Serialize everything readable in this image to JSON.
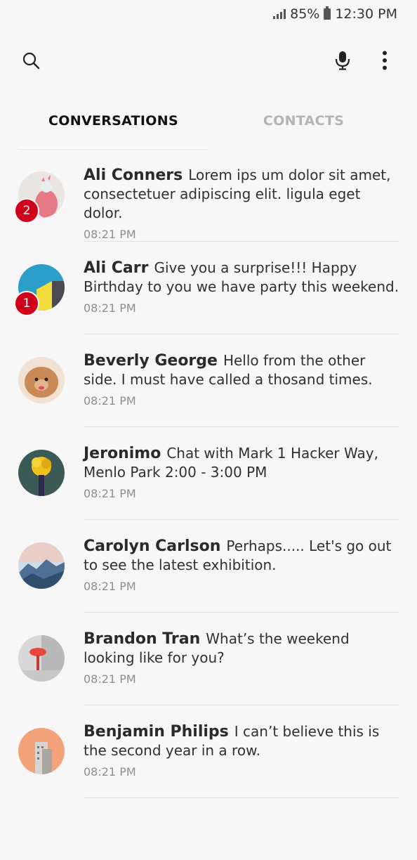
{
  "status_bar": {
    "battery": "85%",
    "time": "12:30 PM"
  },
  "tabs": [
    {
      "label": "CONVERSATIONS",
      "active": true
    },
    {
      "label": "CONTACTS",
      "active": false
    }
  ],
  "conversations": [
    {
      "name": "Ali Conners",
      "message": "Lorem ips um dolor sit amet, consectetuer adipiscing elit. ligula eget dolor.",
      "time": "08:21 PM",
      "unread": "2"
    },
    {
      "name": "Ali Carr",
      "message": "Give you a surprise!!! Happy Birthday to you we have party this weekend.",
      "time": "08:21 PM",
      "unread": "1"
    },
    {
      "name": "Beverly George",
      "message": "Hello from the other side. I must have called a thosand times.",
      "time": "08:21 PM"
    },
    {
      "name": "Jeronimo",
      "message": "Chat with Mark 1 Hacker Way, Menlo Park 2:00 - 3:00 PM",
      "time": "08:21 PM"
    },
    {
      "name": "Carolyn Carlson",
      "message": "Perhaps..... Let's go out to see the latest exhibition.",
      "time": "08:21 PM"
    },
    {
      "name": "Brandon Tran",
      "message": "What’s the weekend looking like for you?",
      "time": "08:21 PM"
    },
    {
      "name": "Benjamin Philips",
      "message": "I can’t believe this is the second year in a row.",
      "time": "08:21 PM"
    }
  ],
  "colors": {
    "badge": "#d0021b",
    "background": "#f7f7f7",
    "inactive_tab": "#b4b4b4"
  },
  "icons": {
    "search": "search-icon",
    "mic": "microphone-icon",
    "more": "more-vertical-icon"
  }
}
